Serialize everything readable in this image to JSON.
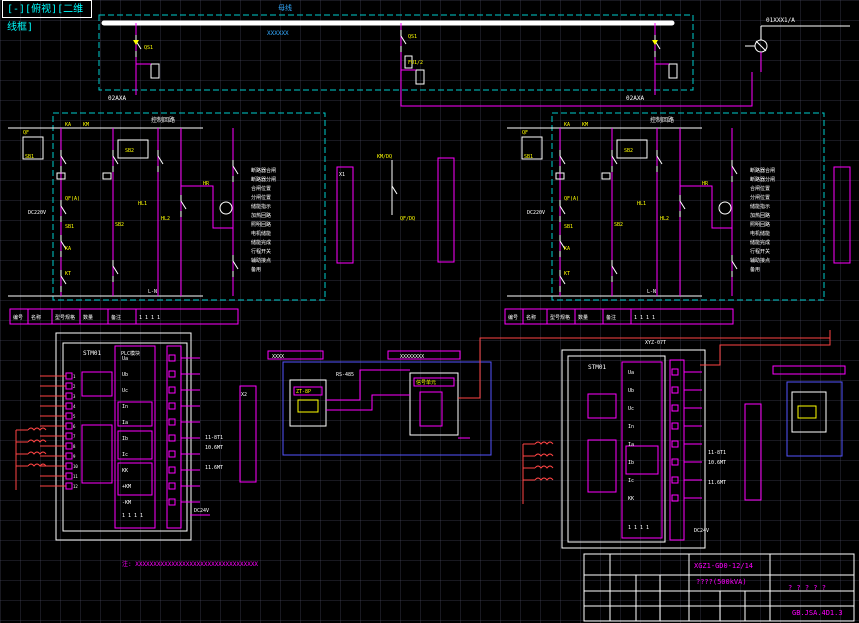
{
  "tab": {
    "title": "[-][俯视][二维线框]"
  },
  "top": {
    "label_top": "母线",
    "label_busbar": "XXXXXX",
    "meter_label": "01XXX1/A",
    "bus_left": "02AXA",
    "bus_right": "02AXA",
    "qs_label": "QS1",
    "fu_label": "FU1/2"
  },
  "left_panel": {
    "header": "控制回路",
    "tags": [
      "QF",
      "KA",
      "KM",
      "SB1",
      "SB2",
      "QF(A)",
      "SB1",
      "SB2",
      "KA",
      "KT",
      "HL1",
      "HL2",
      "HR"
    ],
    "right_col": [
      "断路器合闸",
      "断路器分闸",
      "合闸位置",
      "分闸位置",
      "储能指示",
      "加热回路",
      "照明回路",
      "电机储能",
      "储能完成",
      "行程开关",
      "辅助接点",
      "备用"
    ],
    "bottom": "L-N",
    "side_left": "DC220V"
  },
  "right_panel": {
    "header": "控制回路",
    "tags": [
      "QF",
      "KA",
      "KM",
      "SB1",
      "SB2",
      "QF(A)",
      "SB1",
      "SB2",
      "KA",
      "KT",
      "HL1",
      "HL2",
      "HR"
    ],
    "right_col": [
      "断路器合闸",
      "断路器分闸",
      "合闸位置",
      "分闸位置",
      "储能指示",
      "加热回路",
      "照明回路",
      "电机储能",
      "储能完成",
      "行程开关",
      "辅助接点",
      "备用"
    ],
    "bottom": "L-N",
    "side_left": "DC220V"
  },
  "legend_row_left": [
    "编号",
    "名称",
    "型号规格",
    "数量",
    "备注",
    "1 1 1 1"
  ],
  "legend_row_right": [
    "编号",
    "名称",
    "型号规格",
    "数量",
    "备注",
    "1 1 1 1"
  ],
  "lower_left": {
    "module_title": "STM01",
    "module_sub": "PLC模块",
    "left_pins": [
      "1",
      "2",
      "3",
      "4",
      "5",
      "6",
      "7",
      "8",
      "9",
      "10",
      "11",
      "12"
    ],
    "right_labels": [
      "Ua",
      "Ub",
      "Uc",
      "In",
      "Ia",
      "Ib",
      "Ic",
      "KK",
      "+KM",
      "-KM"
    ],
    "io_notes": [
      "RS485",
      "11-8T1",
      "10.6MT",
      "11.6MT",
      "12.0MT",
      "DC24V"
    ],
    "footer": "1 1 1 1"
  },
  "lower_mid": {
    "header_a": "XXXX",
    "header_b": "XXXXXXXX",
    "unit_a": "ZT-8P",
    "unit_b": "信号单元",
    "ann": "RS-485"
  },
  "lower_right": {
    "module_title": "STM01",
    "module_sub": "XYZ-07T",
    "right_labels": [
      "Ua",
      "Ub",
      "Uc",
      "In",
      "Ia",
      "Ib",
      "Ic",
      "KK"
    ],
    "io_notes": [
      "RS485",
      "11-8T1",
      "10.6MT",
      "11.6MT",
      "12.0MT",
      "DC24V"
    ],
    "footer": "1 1 1 1"
  },
  "note_text": "注: XXXXXXXXXXXXXXXXXXXXXXXXXXXXXXXXXX",
  "titleblock": {
    "model": "XGZ1-GD0-12/14",
    "desc": "????(500kVA)",
    "right_title": "? ? ? ? ?",
    "drawing_no": "GB.JSA.4D1.3"
  }
}
